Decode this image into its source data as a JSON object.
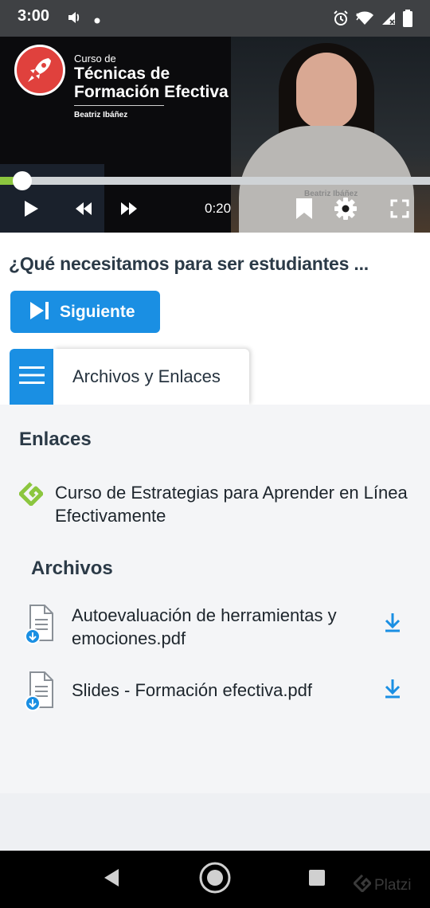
{
  "status_bar": {
    "time": "3:00",
    "icons": [
      "volume-icon",
      "notification-dot-icon",
      "alarm-icon",
      "wifi-icon",
      "signal-icon",
      "battery-icon"
    ]
  },
  "video": {
    "course_prefix": "Curso de",
    "course_title_line1": "Técnicas de",
    "course_title_line2": "Formación Efectiva",
    "course_author": "Beatriz Ibáñez",
    "watermark": "Beatriz Ibáñez",
    "current_time": "0:20",
    "progress_fraction": 0.052,
    "controls": [
      "play-icon",
      "rewind-icon",
      "fast-forward-icon",
      "bookmark-icon",
      "settings-icon",
      "fullscreen-icon"
    ]
  },
  "lesson": {
    "title": "¿Qué necesitamos para ser estudiantes ..."
  },
  "next_button": {
    "label": "Siguiente"
  },
  "tabs": {
    "files_label": "Archivos y Enlaces"
  },
  "links_section": {
    "heading": "Enlaces",
    "items": [
      {
        "text": "Curso de Estrategias para Aprender en Línea Efectivamente"
      }
    ]
  },
  "files_section": {
    "heading": "Archivos",
    "items": [
      {
        "name": "Autoevaluación de herramientas y emociones.pdf"
      },
      {
        "name": "Slides - Formación efectiva.pdf"
      }
    ]
  },
  "brand": {
    "watermark": "Platzi",
    "accent": "#1a8fe3",
    "green": "#8cc63f"
  }
}
